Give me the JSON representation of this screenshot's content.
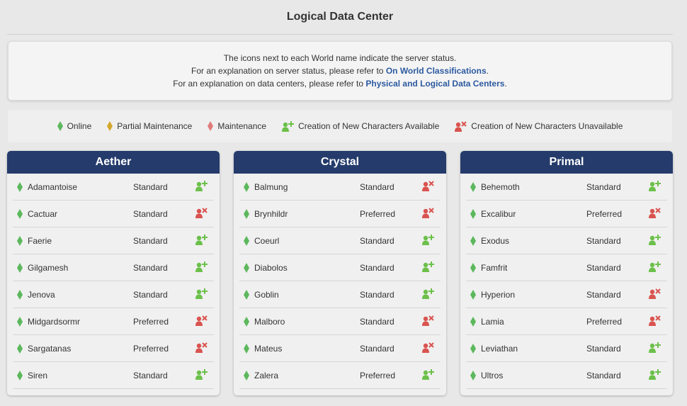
{
  "title": "Logical Data Center",
  "info": {
    "line1": "The icons next to each World name indicate the server status.",
    "line2_prefix": "For an explanation on server status, please refer to ",
    "line2_link": "On World Classifications",
    "line2_suffix": ".",
    "line3_prefix": "For an explanation on data centers, please refer to ",
    "line3_link": "Physical and Logical Data Centers",
    "line3_suffix": "."
  },
  "legend": [
    {
      "icon": "online-diamond-icon",
      "label": "Online"
    },
    {
      "icon": "partial-maintenance-diamond-icon",
      "label": "Partial Maintenance"
    },
    {
      "icon": "maintenance-diamond-icon",
      "label": "Maintenance"
    },
    {
      "icon": "character-creation-available-icon",
      "label": "Creation of New Characters Available"
    },
    {
      "icon": "character-creation-unavailable-icon",
      "label": "Creation of New Characters Unavailable"
    }
  ],
  "colors": {
    "online": "#5cb85c",
    "partial": "#d4a82a",
    "maintenance": "#d9534f",
    "available": "#6cc04a",
    "unavailable": "#d9534f",
    "header": "#243b6b",
    "link": "#2c5aa0"
  },
  "datacenters": [
    {
      "name": "Aether",
      "worlds": [
        {
          "name": "Adamantoise",
          "classification": "Standard",
          "creation": "available"
        },
        {
          "name": "Cactuar",
          "classification": "Standard",
          "creation": "unavailable"
        },
        {
          "name": "Faerie",
          "classification": "Standard",
          "creation": "available"
        },
        {
          "name": "Gilgamesh",
          "classification": "Standard",
          "creation": "available"
        },
        {
          "name": "Jenova",
          "classification": "Standard",
          "creation": "available"
        },
        {
          "name": "Midgardsormr",
          "classification": "Preferred",
          "creation": "unavailable"
        },
        {
          "name": "Sargatanas",
          "classification": "Preferred",
          "creation": "unavailable"
        },
        {
          "name": "Siren",
          "classification": "Standard",
          "creation": "available"
        }
      ]
    },
    {
      "name": "Crystal",
      "worlds": [
        {
          "name": "Balmung",
          "classification": "Standard",
          "creation": "unavailable"
        },
        {
          "name": "Brynhildr",
          "classification": "Preferred",
          "creation": "unavailable"
        },
        {
          "name": "Coeurl",
          "classification": "Standard",
          "creation": "available"
        },
        {
          "name": "Diabolos",
          "classification": "Standard",
          "creation": "available"
        },
        {
          "name": "Goblin",
          "classification": "Standard",
          "creation": "available"
        },
        {
          "name": "Malboro",
          "classification": "Standard",
          "creation": "unavailable"
        },
        {
          "name": "Mateus",
          "classification": "Standard",
          "creation": "unavailable"
        },
        {
          "name": "Zalera",
          "classification": "Preferred",
          "creation": "available"
        }
      ]
    },
    {
      "name": "Primal",
      "worlds": [
        {
          "name": "Behemoth",
          "classification": "Standard",
          "creation": "available"
        },
        {
          "name": "Excalibur",
          "classification": "Preferred",
          "creation": "unavailable"
        },
        {
          "name": "Exodus",
          "classification": "Standard",
          "creation": "available"
        },
        {
          "name": "Famfrit",
          "classification": "Standard",
          "creation": "available"
        },
        {
          "name": "Hyperion",
          "classification": "Standard",
          "creation": "unavailable"
        },
        {
          "name": "Lamia",
          "classification": "Preferred",
          "creation": "unavailable"
        },
        {
          "name": "Leviathan",
          "classification": "Standard",
          "creation": "available"
        },
        {
          "name": "Ultros",
          "classification": "Standard",
          "creation": "available"
        }
      ]
    }
  ]
}
